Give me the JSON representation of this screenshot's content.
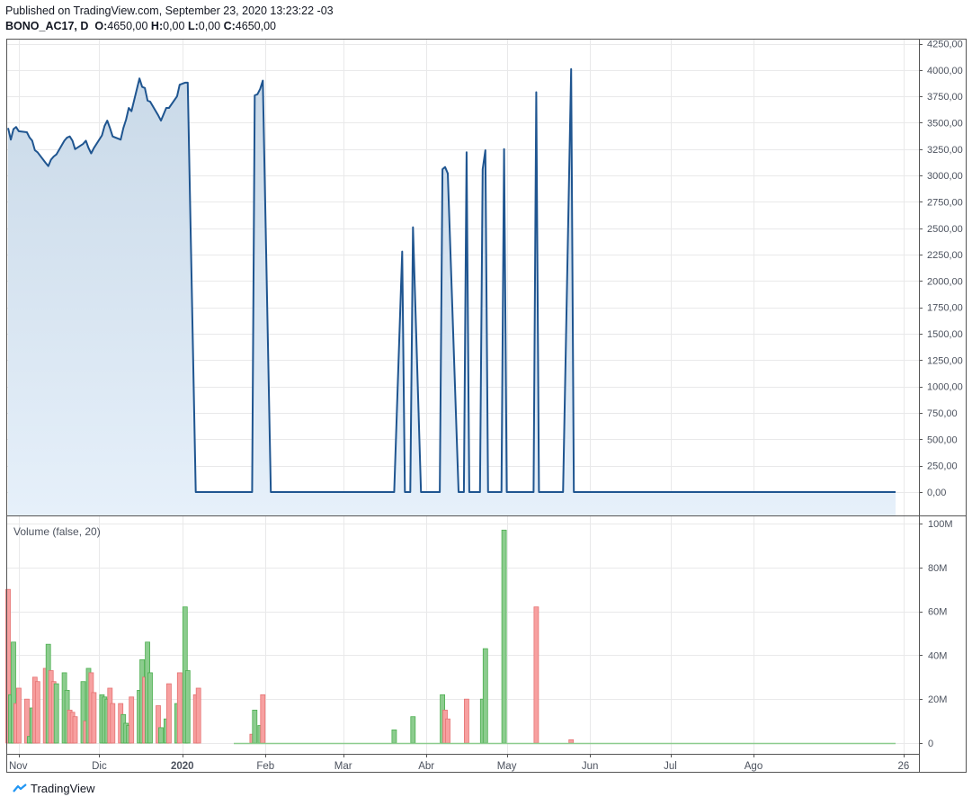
{
  "header": {
    "published": "Published on TradingView.com, September 23, 2020 13:23:22 -03",
    "symbol": "BONO_AC17, D",
    "o_label": "O:",
    "o_value": "4650,00",
    "h_label": "H:",
    "h_value": "0,00",
    "l_label": "L:",
    "l_value": "0,00",
    "c_label": "C:",
    "c_value": "4650,00"
  },
  "footer": {
    "brand": "TradingView",
    "logo_icon": "tradingview-logo-icon"
  },
  "colors": {
    "line": "#1f5590",
    "area_fill_top": "#c9d9e8",
    "area_fill_bottom": "#e6f0fa",
    "vol_up": "#8ccc8e",
    "vol_up_stroke": "#4caf50",
    "vol_down": "#f7a0a0",
    "vol_down_stroke": "#e57373",
    "grid": "#e9e9ea",
    "border": "#555555"
  },
  "chart_data": [
    {
      "type": "area",
      "symbol": "BONO_AC17",
      "interval": "D",
      "x_tick_labels": [
        "Nov",
        "Dic",
        "2020",
        "Feb",
        "Mar",
        "Abr",
        "May",
        "Jun",
        "Jul",
        "Ago",
        "26"
      ],
      "y_tick_labels": [
        "4250,00",
        "4000,00",
        "3750,00",
        "3500,00",
        "3250,00",
        "3000,00",
        "2750,00",
        "2500,00",
        "2250,00",
        "2000,00",
        "1750,00",
        "1500,00",
        "1250,00",
        "1000,00",
        "750,00",
        "500,00",
        "250,00",
        "0,00"
      ],
      "ylim": [
        -230,
        4270
      ],
      "grid": true,
      "series": [
        {
          "points": [
            [
              "2019-10-28",
              3450
            ],
            [
              "2019-10-29",
              3340
            ],
            [
              "2019-10-30",
              3440
            ],
            [
              "2019-10-31",
              3460
            ],
            [
              "2019-11-01",
              3420
            ],
            [
              "2019-11-04",
              3410
            ],
            [
              "2019-11-05",
              3360
            ],
            [
              "2019-11-06",
              3330
            ],
            [
              "2019-11-07",
              3240
            ],
            [
              "2019-11-08",
              3220
            ],
            [
              "2019-11-11",
              3120
            ],
            [
              "2019-11-12",
              3090
            ],
            [
              "2019-11-13",
              3150
            ],
            [
              "2019-11-14",
              3180
            ],
            [
              "2019-11-15",
              3200
            ],
            [
              "2019-11-18",
              3330
            ],
            [
              "2019-11-19",
              3360
            ],
            [
              "2019-11-20",
              3370
            ],
            [
              "2019-11-21",
              3330
            ],
            [
              "2019-11-22",
              3250
            ],
            [
              "2019-11-25",
              3300
            ],
            [
              "2019-11-26",
              3330
            ],
            [
              "2019-11-27",
              3260
            ],
            [
              "2019-11-28",
              3210
            ],
            [
              "2019-11-29",
              3260
            ],
            [
              "2019-12-02",
              3380
            ],
            [
              "2019-12-03",
              3470
            ],
            [
              "2019-12-04",
              3520
            ],
            [
              "2019-12-05",
              3450
            ],
            [
              "2019-12-06",
              3370
            ],
            [
              "2019-12-09",
              3340
            ],
            [
              "2019-12-10",
              3450
            ],
            [
              "2019-12-11",
              3530
            ],
            [
              "2019-12-12",
              3640
            ],
            [
              "2019-12-13",
              3610
            ],
            [
              "2019-12-16",
              3920
            ],
            [
              "2019-12-17",
              3840
            ],
            [
              "2019-12-18",
              3830
            ],
            [
              "2019-12-19",
              3710
            ],
            [
              "2019-12-20",
              3700
            ],
            [
              "2019-12-23",
              3570
            ],
            [
              "2019-12-24",
              3520
            ],
            [
              "2019-12-26",
              3640
            ],
            [
              "2019-12-27",
              3640
            ],
            [
              "2019-12-30",
              3750
            ],
            [
              "2019-12-31",
              3860
            ],
            [
              "2020-01-02",
              3880
            ],
            [
              "2020-01-03",
              3880
            ],
            [
              "2020-01-06",
              0
            ],
            [
              "2020-01-07",
              0
            ],
            [
              "2020-01-27",
              0
            ],
            [
              "2020-01-28",
              3760
            ],
            [
              "2020-01-29",
              3770
            ],
            [
              "2020-01-30",
              3820
            ],
            [
              "2020-01-31",
              3900
            ],
            [
              "2020-02-03",
              0
            ],
            [
              "2020-03-20",
              0
            ],
            [
              "2020-03-23",
              2280
            ],
            [
              "2020-03-24",
              0
            ],
            [
              "2020-03-26",
              0
            ],
            [
              "2020-03-27",
              2510
            ],
            [
              "2020-03-30",
              0
            ],
            [
              "2020-04-06",
              0
            ],
            [
              "2020-04-07",
              3060
            ],
            [
              "2020-04-08",
              3080
            ],
            [
              "2020-04-09",
              3020
            ],
            [
              "2020-04-13",
              0
            ],
            [
              "2020-04-15",
              0
            ],
            [
              "2020-04-16",
              3220
            ],
            [
              "2020-04-17",
              0
            ],
            [
              "2020-04-21",
              0
            ],
            [
              "2020-04-22",
              3060
            ],
            [
              "2020-04-23",
              3240
            ],
            [
              "2020-04-24",
              0
            ],
            [
              "2020-04-29",
              0
            ],
            [
              "2020-04-30",
              3250
            ],
            [
              "2020-05-01",
              0
            ],
            [
              "2020-05-11",
              0
            ],
            [
              "2020-05-12",
              3790
            ],
            [
              "2020-05-13",
              0
            ],
            [
              "2020-05-22",
              0
            ],
            [
              "2020-05-25",
              4010
            ],
            [
              "2020-05-26",
              0
            ],
            [
              "2020-09-23",
              0
            ]
          ]
        }
      ]
    },
    {
      "type": "bar",
      "title": "Volume (false, 20)",
      "y_tick_labels": [
        "100M",
        "80M",
        "60M",
        "40M",
        "20M",
        "0"
      ],
      "ylim": [
        0,
        100000000
      ],
      "grid": true,
      "series": [
        {
          "points": [
            [
              "2019-10-28",
              70000000,
              "down"
            ],
            [
              "2019-10-29",
              22000000,
              "up"
            ],
            [
              "2019-10-30",
              46000000,
              "up"
            ],
            [
              "2019-10-31",
              18000000,
              "down"
            ],
            [
              "2019-11-01",
              25000000,
              "down"
            ],
            [
              "2019-11-04",
              20000000,
              "down"
            ],
            [
              "2019-11-05",
              3000000,
              "up"
            ],
            [
              "2019-11-06",
              16000000,
              "up"
            ],
            [
              "2019-11-07",
              30000000,
              "down"
            ],
            [
              "2019-11-08",
              28000000,
              "down"
            ],
            [
              "2019-11-11",
              34000000,
              "down"
            ],
            [
              "2019-11-12",
              45000000,
              "up"
            ],
            [
              "2019-11-13",
              33000000,
              "down"
            ],
            [
              "2019-11-14",
              28000000,
              "down"
            ],
            [
              "2019-11-15",
              27000000,
              "up"
            ],
            [
              "2019-11-18",
              32000000,
              "up"
            ],
            [
              "2019-11-19",
              24000000,
              "up"
            ],
            [
              "2019-11-20",
              15000000,
              "down"
            ],
            [
              "2019-11-21",
              14000000,
              "down"
            ],
            [
              "2019-11-22",
              12000000,
              "down"
            ],
            [
              "2019-11-25",
              28000000,
              "up"
            ],
            [
              "2019-11-26",
              10000000,
              "down"
            ],
            [
              "2019-11-27",
              34000000,
              "up"
            ],
            [
              "2019-11-28",
              32000000,
              "down"
            ],
            [
              "2019-11-29",
              23000000,
              "down"
            ],
            [
              "2019-12-02",
              22000000,
              "up"
            ],
            [
              "2019-12-03",
              21000000,
              "up"
            ],
            [
              "2019-12-04",
              20000000,
              "up"
            ],
            [
              "2019-12-05",
              25000000,
              "down"
            ],
            [
              "2019-12-06",
              18000000,
              "down"
            ],
            [
              "2019-12-09",
              18000000,
              "down"
            ],
            [
              "2019-12-10",
              13000000,
              "up"
            ],
            [
              "2019-12-11",
              9000000,
              "up"
            ],
            [
              "2019-12-12",
              8000000,
              "up"
            ],
            [
              "2019-12-13",
              21000000,
              "down"
            ],
            [
              "2019-12-16",
              24000000,
              "up"
            ],
            [
              "2019-12-17",
              38000000,
              "up"
            ],
            [
              "2019-12-18",
              30000000,
              "down"
            ],
            [
              "2019-12-19",
              46000000,
              "up"
            ],
            [
              "2019-12-20",
              32000000,
              "up"
            ],
            [
              "2019-12-23",
              17000000,
              "down"
            ],
            [
              "2019-12-24",
              7000000,
              "up"
            ],
            [
              "2019-12-26",
              11000000,
              "up"
            ],
            [
              "2019-12-27",
              27000000,
              "down"
            ],
            [
              "2019-12-30",
              18000000,
              "up"
            ],
            [
              "2019-12-31",
              32000000,
              "down"
            ],
            [
              "2020-01-02",
              62000000,
              "up"
            ],
            [
              "2020-01-03",
              33000000,
              "up"
            ],
            [
              "2020-01-06",
              22000000,
              "down"
            ],
            [
              "2020-01-07",
              25000000,
              "down"
            ],
            [
              "2020-01-27",
              4000000,
              "down"
            ],
            [
              "2020-01-28",
              15000000,
              "up"
            ],
            [
              "2020-01-30",
              8000000,
              "up"
            ],
            [
              "2020-01-31",
              22000000,
              "down"
            ],
            [
              "2020-03-20",
              6000000,
              "up"
            ],
            [
              "2020-03-27",
              12000000,
              "up"
            ],
            [
              "2020-04-07",
              22000000,
              "up"
            ],
            [
              "2020-04-08",
              15000000,
              "down"
            ],
            [
              "2020-04-09",
              11000000,
              "down"
            ],
            [
              "2020-04-16",
              20000000,
              "down"
            ],
            [
              "2020-04-22",
              20000000,
              "up"
            ],
            [
              "2020-04-23",
              43000000,
              "up"
            ],
            [
              "2020-04-30",
              97000000,
              "up"
            ],
            [
              "2020-05-12",
              62000000,
              "down"
            ],
            [
              "2020-05-25",
              1500000,
              "down"
            ]
          ]
        }
      ]
    }
  ]
}
